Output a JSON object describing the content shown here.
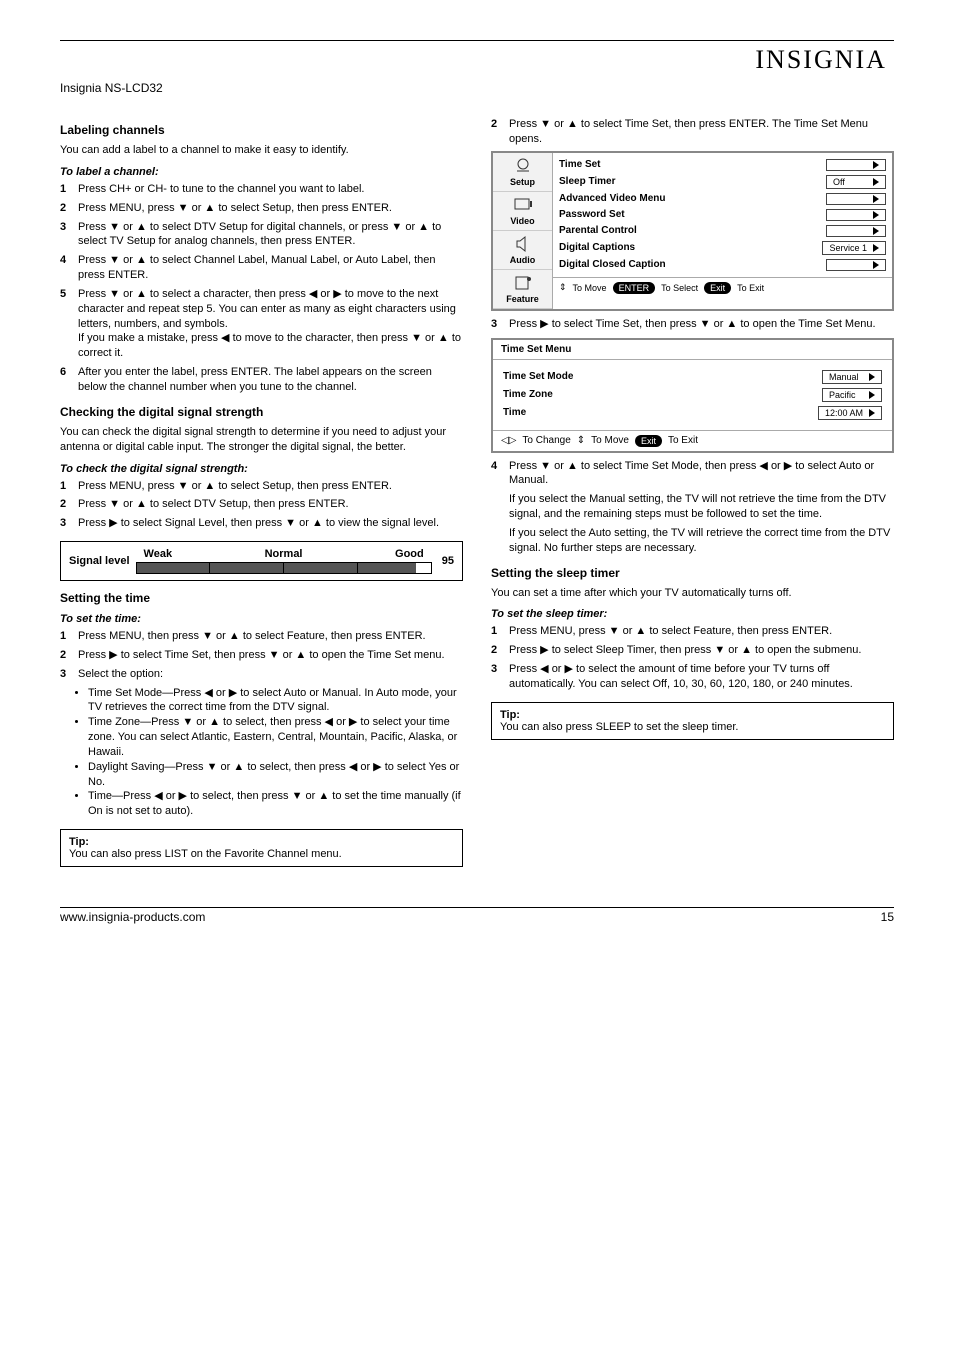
{
  "header": {
    "brand": "INSIGNIA",
    "model_line": "Insignia NS-LCD32"
  },
  "left": {
    "heading_channels": "Labeling channels",
    "intro_channels": "You can add a label to a channel to make it easy to identify.",
    "to_label_heading": "To label a channel:",
    "steps_label": [
      {
        "n": "1",
        "t": "Press CH+ or CH- to tune to the channel you want to label."
      },
      {
        "n": "2",
        "t": "Press MENU, press ▼ or ▲ to select Setup, then press ENTER."
      },
      {
        "n": "3",
        "t": "Press ▼ or ▲ to select DTV Setup for digital channels, or press ▼ or ▲ to select TV Setup for analog channels, then press ENTER."
      },
      {
        "n": "4",
        "t": "Press ▼ or ▲ to select Channel Label, Manual Label, or Auto Label, then press ENTER."
      },
      {
        "n": "5",
        "t_pre": "Press ▼ or ▲ to select a character, then press ◀ or ▶ to move to the next character and repeat step 5. You can enter as many as eight characters using letters, numbers, and symbols.",
        "t_post": "If you make a mistake, press ◀ to move to the character, then press ▼ or ▲ to correct it."
      },
      {
        "n": "6",
        "t": "After you enter the label, press ENTER. The label appears on the screen below the channel number when you tune to the channel."
      }
    ],
    "heading_signal": "Checking the digital signal strength",
    "intro_signal": "You can check the digital signal strength to determine if you need to adjust your antenna or digital cable input. The stronger the digital signal, the better.",
    "to_signal_heading": "To check the digital signal strength:",
    "steps_signal": [
      {
        "n": "1",
        "t": "Press MENU, press ▼ or ▲ to select Setup, then press ENTER."
      },
      {
        "n": "2",
        "t": "Press ▼ or ▲ to select DTV Setup, then press ENTER."
      },
      {
        "n": "3",
        "t": "Press ▶ to select Signal Level, then press ▼ or ▲ to view the signal level."
      }
    ],
    "heading_time": "Setting the time",
    "to_time_heading": "To set the time:",
    "steps_time": [
      {
        "n": "1",
        "t": "Press MENU, then press ▼ or ▲ to select Feature, then press ENTER."
      },
      {
        "n": "2",
        "t": "Press ▶ to select Time Set, then press ▼ or ▲ to open the Time Set menu."
      },
      {
        "n": "3",
        "t": "Select the option:"
      }
    ],
    "time_bullets": [
      "Time Set Mode—Press ◀ or ▶ to select Auto or Manual. In Auto mode, your TV retrieves the correct time from the DTV signal.",
      "Time Zone—Press ▼ or ▲ to select, then press ◀ or ▶ to select your time zone. You can select Atlantic, Eastern, Central, Mountain, Pacific, Alaska, or Hawaii.",
      "Daylight Saving—Press ▼ or ▲ to select, then press ◀ or ▶ to select Yes or No.",
      "Time—Press ◀ or ▶ to select, then press ▼ or ▲ to set the time manually (if On is not set to auto)."
    ],
    "tip_label": "Tip:",
    "tip_text": "You can also press LIST on the Favorite Channel menu."
  },
  "right": {
    "steps_top": [
      {
        "n": "2",
        "t": "Press ▼ or ▲ to select Time Set, then press ENTER. The Time Set Menu opens."
      }
    ],
    "tv_menu": {
      "tabs": [
        "Setup",
        "Video",
        "Audio",
        "Feature"
      ],
      "rows": [
        {
          "label": "Time Set",
          "val": ""
        },
        {
          "label": "Sleep Timer",
          "val": "Off"
        },
        {
          "label": "Advanced Video Menu",
          "val": ""
        },
        {
          "label": "Password Set",
          "val": ""
        },
        {
          "label": "Parental Control",
          "val": ""
        },
        {
          "label": "Digital Captions",
          "val": "Service 1"
        },
        {
          "label": "Digital Closed Caption",
          "val": ""
        }
      ],
      "footer_move": "To Move",
      "footer_enter": "ENTER",
      "footer_select": "To Select",
      "footer_exit": "Exit",
      "footer_toexit": "To Exit"
    },
    "steps_mid": [
      {
        "n": "3",
        "t": "Press ▶ to select Time Set, then press ▼ or ▲ to open the Time Set Menu."
      }
    ],
    "ts_menu": {
      "title": "Time Set Menu",
      "rows": [
        {
          "label": "Time Set Mode",
          "val": "Manual"
        },
        {
          "label": "Time Zone",
          "val": "Pacific"
        },
        {
          "label": "Time",
          "val": "12:00 AM"
        }
      ],
      "footer_change": "To Change",
      "footer_move": "To Move",
      "footer_exit": "Exit",
      "footer_toexit": "To Exit"
    },
    "steps_after_ts": [
      {
        "n": "4",
        "t": "Press ▼ or ▲ to select Time Set Mode, then press ◀ or ▶ to select Auto or Manual."
      }
    ],
    "manual_note": "If you select the Manual setting, the TV will not retrieve the time from the DTV signal, and the remaining steps must be followed to set the time.",
    "auto_note": "If you select the Auto setting, the TV will retrieve the correct time from the DTV signal. No further steps are necessary.",
    "heading_sleep": "Setting the sleep timer",
    "intro_sleep": "You can set a time after which your TV automatically turns off.",
    "to_sleep_heading": "To set the sleep timer:",
    "steps_sleep": [
      {
        "n": "1",
        "t": "Press MENU, press ▼ or ▲ to select Feature, then press ENTER."
      },
      {
        "n": "2",
        "t": "Press ▶ to select Sleep Timer, then press ▼ or ▲ to open the submenu."
      },
      {
        "n": "3",
        "t": "Press ◀ or ▶ to select the amount of time before your TV turns off automatically. You can select Off, 10, 30, 60, 120, 180, or 240 minutes."
      }
    ],
    "tip_label": "Tip:",
    "tip_text": "You can also press SLEEP to set the sleep timer."
  },
  "signal_meter": {
    "label": "Signal level",
    "scale": [
      "Weak",
      "Normal",
      "Good"
    ],
    "value": "95",
    "fill_percent": 95
  },
  "footer": {
    "www": "www.insignia-products.com",
    "page": "15"
  }
}
